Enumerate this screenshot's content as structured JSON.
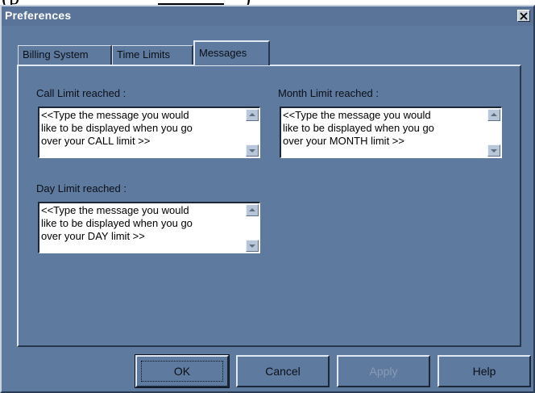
{
  "background_fragment": {
    "text": "(p",
    "gap_text": ")"
  },
  "window": {
    "title": "Preferences",
    "close_glyph": "×"
  },
  "tabs": [
    {
      "label": "Billing System",
      "active": false
    },
    {
      "label": "Time Limits",
      "active": false
    },
    {
      "label": "Messages",
      "active": true
    }
  ],
  "messages": {
    "call": {
      "label": "Call Limit reached :",
      "lines": [
        "<<Type the message you would",
        "like to be displayed when you go",
        "over your CALL limit >>"
      ]
    },
    "month": {
      "label": "Month Limit reached :",
      "lines": [
        "<<Type the message you would",
        "like to be displayed when you go",
        "over your MONTH  limit >>"
      ]
    },
    "day": {
      "label": "Day Limit reached :",
      "lines": [
        "<<Type the message you would",
        "like to be displayed when you go",
        "over your DAY limit >>"
      ]
    }
  },
  "buttons": {
    "ok": "OK",
    "cancel": "Cancel",
    "apply": "Apply",
    "help": "Help"
  },
  "colors": {
    "dialog_face": "#5e7a9e",
    "highlight": "#e2e8f1",
    "shadow": "#1c2838",
    "disabled_text": "#8a9cb6"
  },
  "icons": {
    "close": "close-icon",
    "scroll_up": "scroll-up-arrow-icon",
    "scroll_down": "scroll-down-arrow-icon"
  }
}
